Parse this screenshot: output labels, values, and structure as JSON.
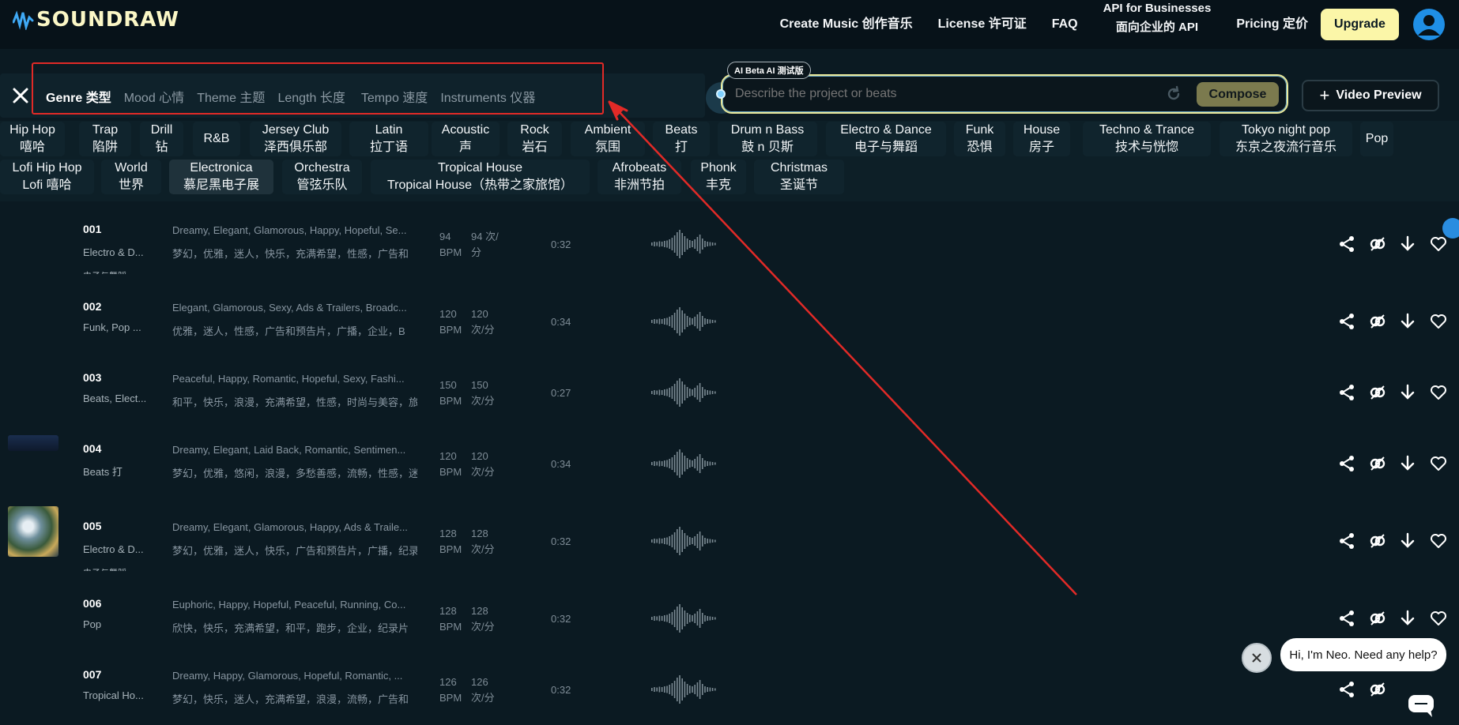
{
  "header": {
    "logo_text": "SOUNDRAW",
    "nav": [
      {
        "label": "Create Music 创作音乐"
      },
      {
        "label": "License 许可证"
      },
      {
        "label": "FAQ"
      },
      {
        "label_line1": "API for Businesses",
        "label_line2": "面向企业的 API"
      },
      {
        "label": "Pricing 定价"
      }
    ],
    "upgrade": "Upgrade"
  },
  "filters": {
    "tabs": [
      "Genre 类型",
      "Mood 心情",
      "Theme 主题",
      "Length 长度",
      "Tempo 速度",
      "Instruments 仪器"
    ],
    "active_index": 0
  },
  "ai": {
    "badge": "AI Beta  AI 测试版",
    "placeholder": "Describe the project or beats",
    "compose": "Compose",
    "video_preview": "Video Preview"
  },
  "genres_row1": [
    {
      "en": "Hip Hop",
      "zh": "嘻哈"
    },
    {
      "en": "Trap",
      "zh": "陷阱"
    },
    {
      "en": "Drill",
      "zh": "钻"
    },
    {
      "en": "R&B",
      "zh": ""
    },
    {
      "en": "Jersey Club",
      "zh": "泽西俱乐部"
    },
    {
      "en": "Latin",
      "zh": "拉丁语"
    },
    {
      "en": "Acoustic",
      "zh": "声"
    },
    {
      "en": "Rock",
      "zh": "岩石"
    },
    {
      "en": "Ambient",
      "zh": "氛围"
    },
    {
      "en": "Beats",
      "zh": "打"
    },
    {
      "en": "Drum n Bass",
      "zh": "鼓 n 贝斯"
    },
    {
      "en": "Electro & Dance",
      "zh": "电子与舞蹈"
    },
    {
      "en": "Funk",
      "zh": "恐惧"
    },
    {
      "en": "House",
      "zh": "房子"
    },
    {
      "en": "Techno & Trance",
      "zh": "技术与恍惚"
    },
    {
      "en": "Tokyo night pop",
      "zh": "东京之夜流行音乐"
    },
    {
      "en": "Pop",
      "zh": ""
    }
  ],
  "genres_row2": [
    {
      "en": "Lofi Hip Hop",
      "zh": "Lofi 嘻哈"
    },
    {
      "en": "World",
      "zh": "世界"
    },
    {
      "en": "Electronica",
      "zh": "慕尼黑电子展"
    },
    {
      "en": "Orchestra",
      "zh": "管弦乐队"
    },
    {
      "en": "Tropical House",
      "zh": "Tropical House（热带之家旅馆）"
    },
    {
      "en": "Afrobeats",
      "zh": "非洲节拍"
    },
    {
      "en": "Phonk",
      "zh": "丰克"
    },
    {
      "en": "Christmas",
      "zh": "圣诞节"
    }
  ],
  "tracks": [
    {
      "num": "001",
      "genre": "Electro & D...",
      "genre_zh": "电子与舞蹈",
      "mood": "Dreamy, Elegant, Glamorous, Happy, Hopeful, Se...",
      "mood_zh": "梦幻，优雅，迷人，快乐，充满希望，性感，广告和",
      "bpm": "94",
      "bpm_unit": "BPM",
      "bpm_zh": "94 次/",
      "bpm_zh2": "分",
      "duration": "0:32",
      "thumb": "none"
    },
    {
      "num": "002",
      "genre": "Funk, Pop ...",
      "genre_zh": "",
      "mood": "Elegant, Glamorous, Sexy, Ads & Trailers, Broadc...",
      "mood_zh": "优雅，迷人，性感，广告和预告片，广播，企业，B",
      "bpm": "120",
      "bpm_unit": "BPM",
      "bpm_zh": "120",
      "bpm_zh2": "次/分",
      "duration": "0:34",
      "thumb": "none"
    },
    {
      "num": "003",
      "genre": "Beats, Elect...",
      "genre_zh": "",
      "mood": "Peaceful, Happy, Romantic, Hopeful, Sexy, Fashi...",
      "mood_zh": "和平，快乐，浪漫，充满希望，性感，时尚与美容，旅",
      "bpm": "150",
      "bpm_unit": "BPM",
      "bpm_zh": "150",
      "bpm_zh2": "次/分",
      "duration": "0:27",
      "thumb": "none"
    },
    {
      "num": "004",
      "genre": "Beats 打",
      "genre_zh": "",
      "mood": "Dreamy, Elegant, Laid Back, Romantic, Sentimen...",
      "mood_zh": "梦幻，优雅，悠闲，浪漫，多愁善感，流畅，性感，迷",
      "bpm": "120",
      "bpm_unit": "BPM",
      "bpm_zh": "120",
      "bpm_zh2": "次/分",
      "duration": "0:34",
      "thumb": "dark"
    },
    {
      "num": "005",
      "genre": "Electro & D...",
      "genre_zh": "电子与舞蹈",
      "mood": "Dreamy, Elegant, Glamorous, Happy, Ads & Traile...",
      "mood_zh": "梦幻，优雅，迷人，快乐，广告和预告片，广播，纪录",
      "bpm": "128",
      "bpm_unit": "BPM",
      "bpm_zh": "128",
      "bpm_zh2": "次/分",
      "duration": "0:32",
      "thumb": "disco"
    },
    {
      "num": "006",
      "genre": "Pop",
      "genre_zh": "",
      "mood": "Euphoric, Happy, Hopeful, Peaceful, Running, Co...",
      "mood_zh": "欣快，快乐，充满希望，和平，跑步，企业，纪录片",
      "bpm": "128",
      "bpm_unit": "BPM",
      "bpm_zh": "128",
      "bpm_zh2": "次/分",
      "duration": "0:32",
      "thumb": "none"
    },
    {
      "num": "007",
      "genre": "Tropical Ho...",
      "genre_zh": "",
      "mood": "Dreamy, Happy, Glamorous, Hopeful, Romantic, ...",
      "mood_zh": "梦幻，快乐，迷人，充满希望，浪漫，流畅，广告和",
      "bpm": "126",
      "bpm_unit": "BPM",
      "bpm_zh": "126",
      "bpm_zh2": "次/分",
      "duration": "0:32",
      "thumb": "none"
    }
  ],
  "chat": {
    "message": "Hi, I'm Neo. Need any help?"
  },
  "colors": {
    "background": "#0b1a22",
    "header": "#071219",
    "accent_yellow": "#fbf6a8",
    "annotation_red": "#e12a27",
    "avatar_blue": "#1f8fe6"
  }
}
